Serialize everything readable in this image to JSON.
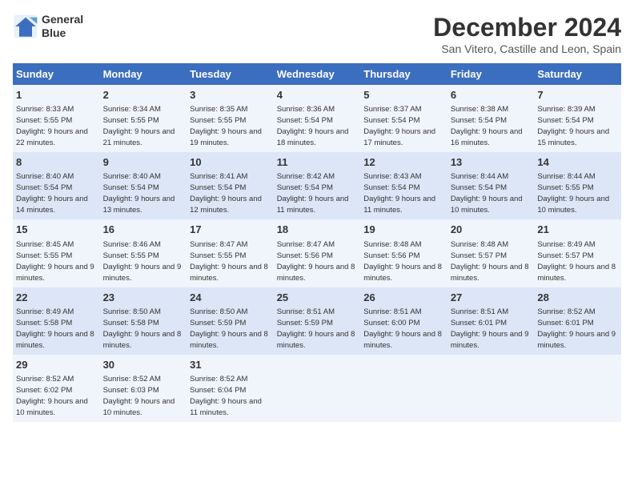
{
  "header": {
    "logo_line1": "General",
    "logo_line2": "Blue",
    "month": "December 2024",
    "location": "San Vitero, Castille and Leon, Spain"
  },
  "days_of_week": [
    "Sunday",
    "Monday",
    "Tuesday",
    "Wednesday",
    "Thursday",
    "Friday",
    "Saturday"
  ],
  "weeks": [
    [
      {
        "day": "1",
        "sunrise": "8:33 AM",
        "sunset": "5:55 PM",
        "daylight": "9 hours and 22 minutes."
      },
      {
        "day": "2",
        "sunrise": "8:34 AM",
        "sunset": "5:55 PM",
        "daylight": "9 hours and 21 minutes."
      },
      {
        "day": "3",
        "sunrise": "8:35 AM",
        "sunset": "5:55 PM",
        "daylight": "9 hours and 19 minutes."
      },
      {
        "day": "4",
        "sunrise": "8:36 AM",
        "sunset": "5:54 PM",
        "daylight": "9 hours and 18 minutes."
      },
      {
        "day": "5",
        "sunrise": "8:37 AM",
        "sunset": "5:54 PM",
        "daylight": "9 hours and 17 minutes."
      },
      {
        "day": "6",
        "sunrise": "8:38 AM",
        "sunset": "5:54 PM",
        "daylight": "9 hours and 16 minutes."
      },
      {
        "day": "7",
        "sunrise": "8:39 AM",
        "sunset": "5:54 PM",
        "daylight": "9 hours and 15 minutes."
      }
    ],
    [
      {
        "day": "8",
        "sunrise": "8:40 AM",
        "sunset": "5:54 PM",
        "daylight": "9 hours and 14 minutes."
      },
      {
        "day": "9",
        "sunrise": "8:40 AM",
        "sunset": "5:54 PM",
        "daylight": "9 hours and 13 minutes."
      },
      {
        "day": "10",
        "sunrise": "8:41 AM",
        "sunset": "5:54 PM",
        "daylight": "9 hours and 12 minutes."
      },
      {
        "day": "11",
        "sunrise": "8:42 AM",
        "sunset": "5:54 PM",
        "daylight": "9 hours and 11 minutes."
      },
      {
        "day": "12",
        "sunrise": "8:43 AM",
        "sunset": "5:54 PM",
        "daylight": "9 hours and 11 minutes."
      },
      {
        "day": "13",
        "sunrise": "8:44 AM",
        "sunset": "5:54 PM",
        "daylight": "9 hours and 10 minutes."
      },
      {
        "day": "14",
        "sunrise": "8:44 AM",
        "sunset": "5:55 PM",
        "daylight": "9 hours and 10 minutes."
      }
    ],
    [
      {
        "day": "15",
        "sunrise": "8:45 AM",
        "sunset": "5:55 PM",
        "daylight": "9 hours and 9 minutes."
      },
      {
        "day": "16",
        "sunrise": "8:46 AM",
        "sunset": "5:55 PM",
        "daylight": "9 hours and 9 minutes."
      },
      {
        "day": "17",
        "sunrise": "8:47 AM",
        "sunset": "5:55 PM",
        "daylight": "9 hours and 8 minutes."
      },
      {
        "day": "18",
        "sunrise": "8:47 AM",
        "sunset": "5:56 PM",
        "daylight": "9 hours and 8 minutes."
      },
      {
        "day": "19",
        "sunrise": "8:48 AM",
        "sunset": "5:56 PM",
        "daylight": "9 hours and 8 minutes."
      },
      {
        "day": "20",
        "sunrise": "8:48 AM",
        "sunset": "5:57 PM",
        "daylight": "9 hours and 8 minutes."
      },
      {
        "day": "21",
        "sunrise": "8:49 AM",
        "sunset": "5:57 PM",
        "daylight": "9 hours and 8 minutes."
      }
    ],
    [
      {
        "day": "22",
        "sunrise": "8:49 AM",
        "sunset": "5:58 PM",
        "daylight": "9 hours and 8 minutes."
      },
      {
        "day": "23",
        "sunrise": "8:50 AM",
        "sunset": "5:58 PM",
        "daylight": "9 hours and 8 minutes."
      },
      {
        "day": "24",
        "sunrise": "8:50 AM",
        "sunset": "5:59 PM",
        "daylight": "9 hours and 8 minutes."
      },
      {
        "day": "25",
        "sunrise": "8:51 AM",
        "sunset": "5:59 PM",
        "daylight": "9 hours and 8 minutes."
      },
      {
        "day": "26",
        "sunrise": "8:51 AM",
        "sunset": "6:00 PM",
        "daylight": "9 hours and 8 minutes."
      },
      {
        "day": "27",
        "sunrise": "8:51 AM",
        "sunset": "6:01 PM",
        "daylight": "9 hours and 9 minutes."
      },
      {
        "day": "28",
        "sunrise": "8:52 AM",
        "sunset": "6:01 PM",
        "daylight": "9 hours and 9 minutes."
      }
    ],
    [
      {
        "day": "29",
        "sunrise": "8:52 AM",
        "sunset": "6:02 PM",
        "daylight": "9 hours and 10 minutes."
      },
      {
        "day": "30",
        "sunrise": "8:52 AM",
        "sunset": "6:03 PM",
        "daylight": "9 hours and 10 minutes."
      },
      {
        "day": "31",
        "sunrise": "8:52 AM",
        "sunset": "6:04 PM",
        "daylight": "9 hours and 11 minutes."
      },
      null,
      null,
      null,
      null
    ]
  ]
}
